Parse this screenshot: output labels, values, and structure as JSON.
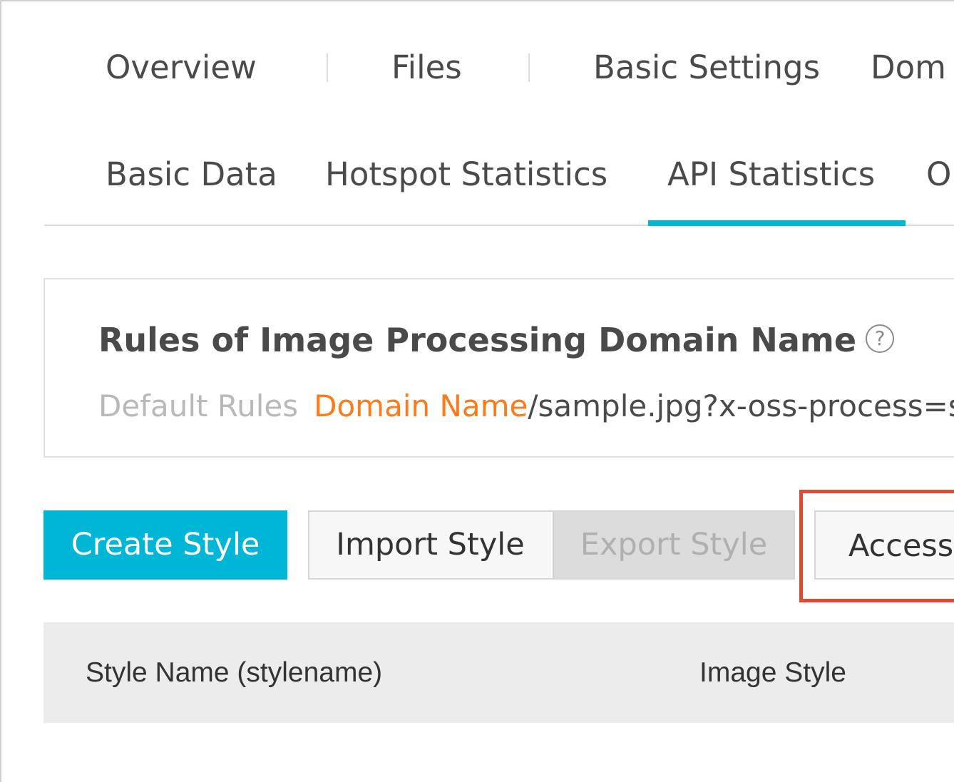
{
  "primary_nav": {
    "items": [
      {
        "label": "Overview"
      },
      {
        "label": "Files"
      },
      {
        "label": "Basic Settings"
      },
      {
        "label": "Dom"
      }
    ]
  },
  "tabs": {
    "items": [
      {
        "label": "Basic Data"
      },
      {
        "label": "Hotspot Statistics"
      },
      {
        "label": "API Statistics",
        "active": true
      },
      {
        "label": "O"
      }
    ]
  },
  "rules": {
    "title": "Rules of Image Processing Domain Name",
    "help_icon": "?",
    "default_label": "Default Rules",
    "domain_text": "Domain Name",
    "path_text": "/sample.jpg?x-oss-process=st"
  },
  "toolbar": {
    "create_label": "Create Style",
    "import_label": "Import Style",
    "export_label": "Export Style",
    "access_label": "Access"
  },
  "table": {
    "columns": [
      "Style Name (stylename)",
      "Image Style"
    ]
  },
  "colors": {
    "accent": "#00b6d6",
    "highlight": "#e2492f",
    "domain_orange": "#ff7a1a"
  }
}
